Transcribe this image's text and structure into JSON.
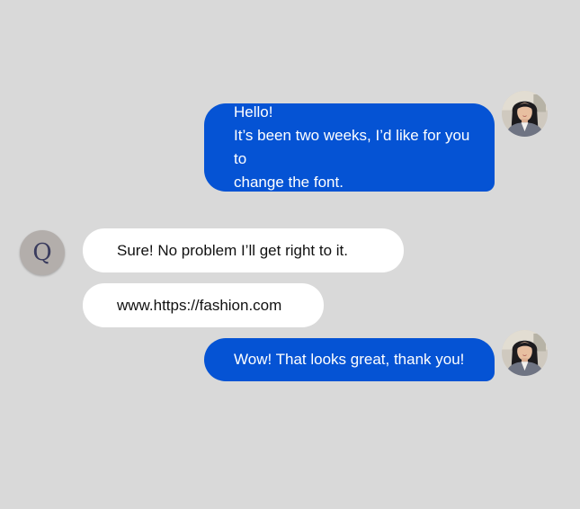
{
  "conversation": {
    "messages": [
      {
        "sender": "user",
        "lines": [
          "Hello!",
          "It’s been two weeks, I’d like for you to",
          "change the font."
        ]
      },
      {
        "sender": "agent",
        "text": "Sure! No problem I’ll get right to it."
      },
      {
        "sender": "agent",
        "text": "www.https://fashion.com"
      },
      {
        "sender": "user",
        "text": "Wow! That looks great, thank you!"
      }
    ],
    "agent_avatar": {
      "letter": "Q"
    }
  },
  "colors": {
    "background": "#d9d9d9",
    "user_bubble": "#0553d4",
    "agent_bubble": "#ffffff"
  }
}
